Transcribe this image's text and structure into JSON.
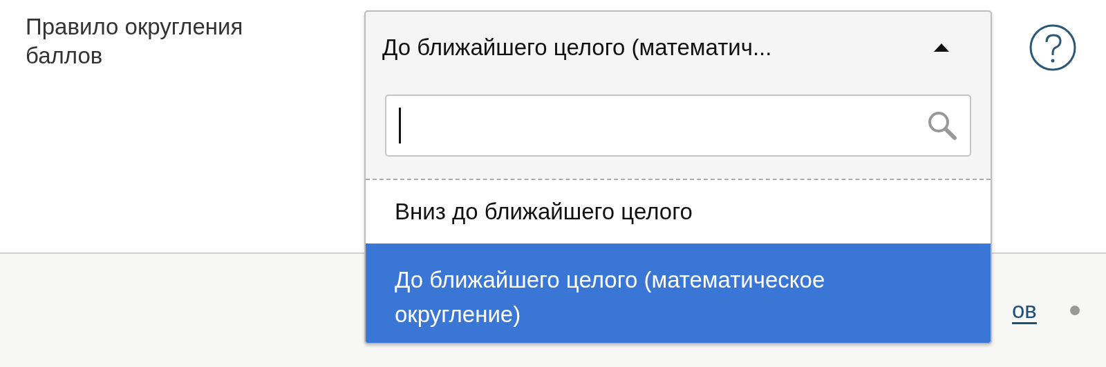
{
  "field": {
    "label": "Правило округления баллов"
  },
  "dropdown": {
    "value": "До ближайшего целого (математич...",
    "expanded": true,
    "options": [
      {
        "label": "Вниз до ближайшего целого",
        "selected": false
      },
      {
        "label": "До ближайшего целого (математическое округление)",
        "selected": true
      }
    ]
  },
  "footer": {
    "link": "ов"
  }
}
